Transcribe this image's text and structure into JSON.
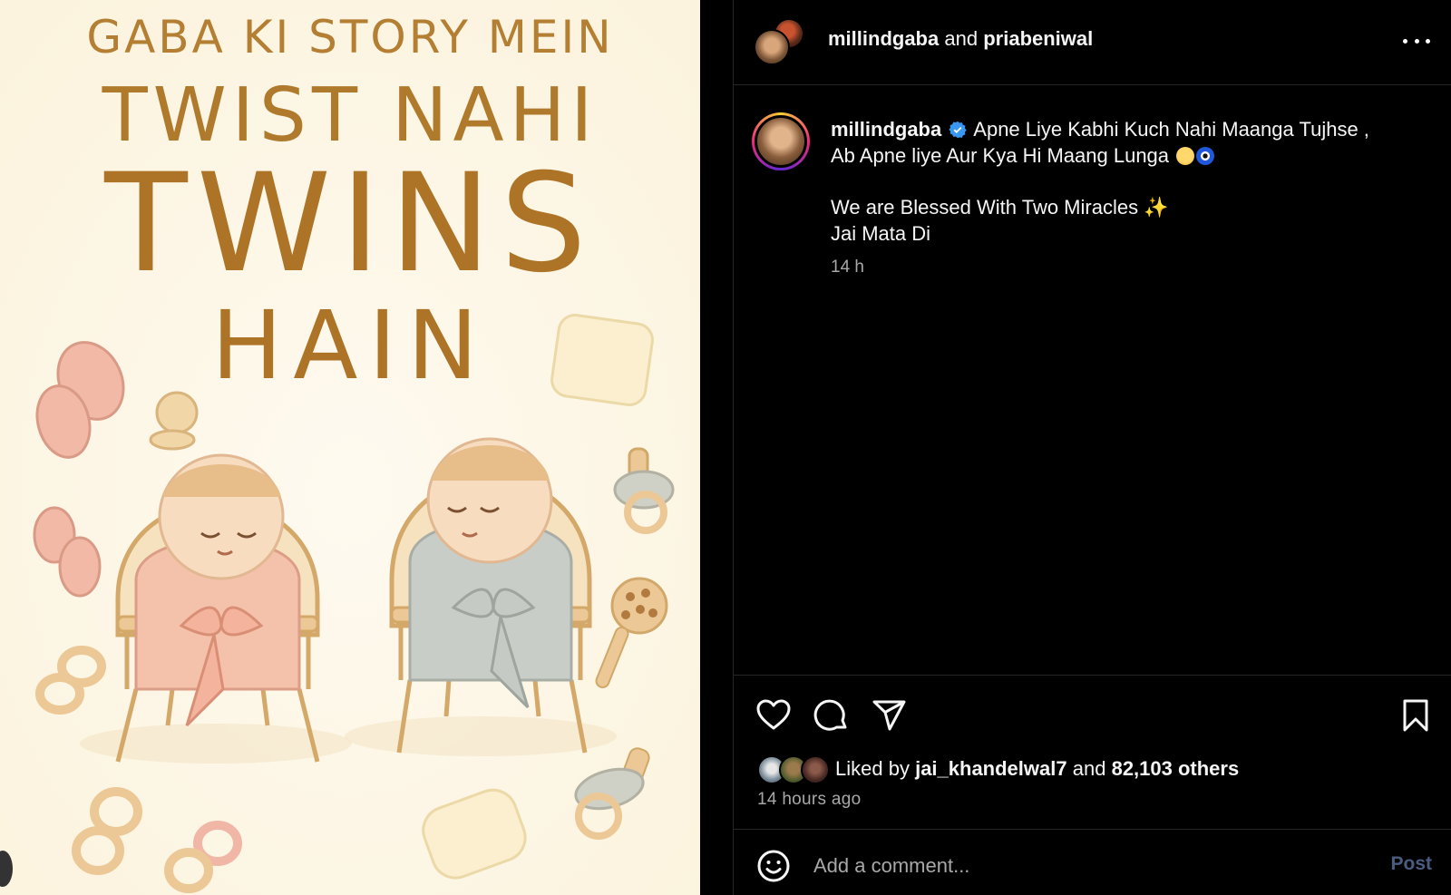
{
  "poster": {
    "line1": "GABA KI STORY MEIN",
    "line2": "TWIST NAHI",
    "line3": "TWINS",
    "line4": "HAIN"
  },
  "header": {
    "user1": "millindgaba",
    "joiner": "and",
    "user2": "priabeniwal"
  },
  "caption": {
    "username": "millindgaba",
    "line1": "Apne Liye Kabhi Kuch Nahi Maanga Tujhse ,",
    "line2": "Ab Apne liye Aur Kya Hi Maang Lunga",
    "line3": "We are Blessed With Two Miracles",
    "sparkle": "✨",
    "line4": "Jai Mata Di",
    "time": "14 h"
  },
  "likes": {
    "prefix": "Liked by",
    "user": "jai_khandelwal7",
    "joiner": "and",
    "others": "82,103 others",
    "time": "14 hours ago"
  },
  "comment": {
    "placeholder": "Add a comment...",
    "post_label": "Post"
  },
  "colors": {
    "background": "#000000",
    "divider": "#262626",
    "muted": "#a8a8a8",
    "verified": "#3897f0",
    "post_button_disabled": "#4a5d80",
    "poster_gold": "#ad7427"
  },
  "icons": [
    "more-icon",
    "verified-icon",
    "like-icon",
    "comment-icon",
    "share-icon",
    "save-icon",
    "emoji-icon"
  ]
}
